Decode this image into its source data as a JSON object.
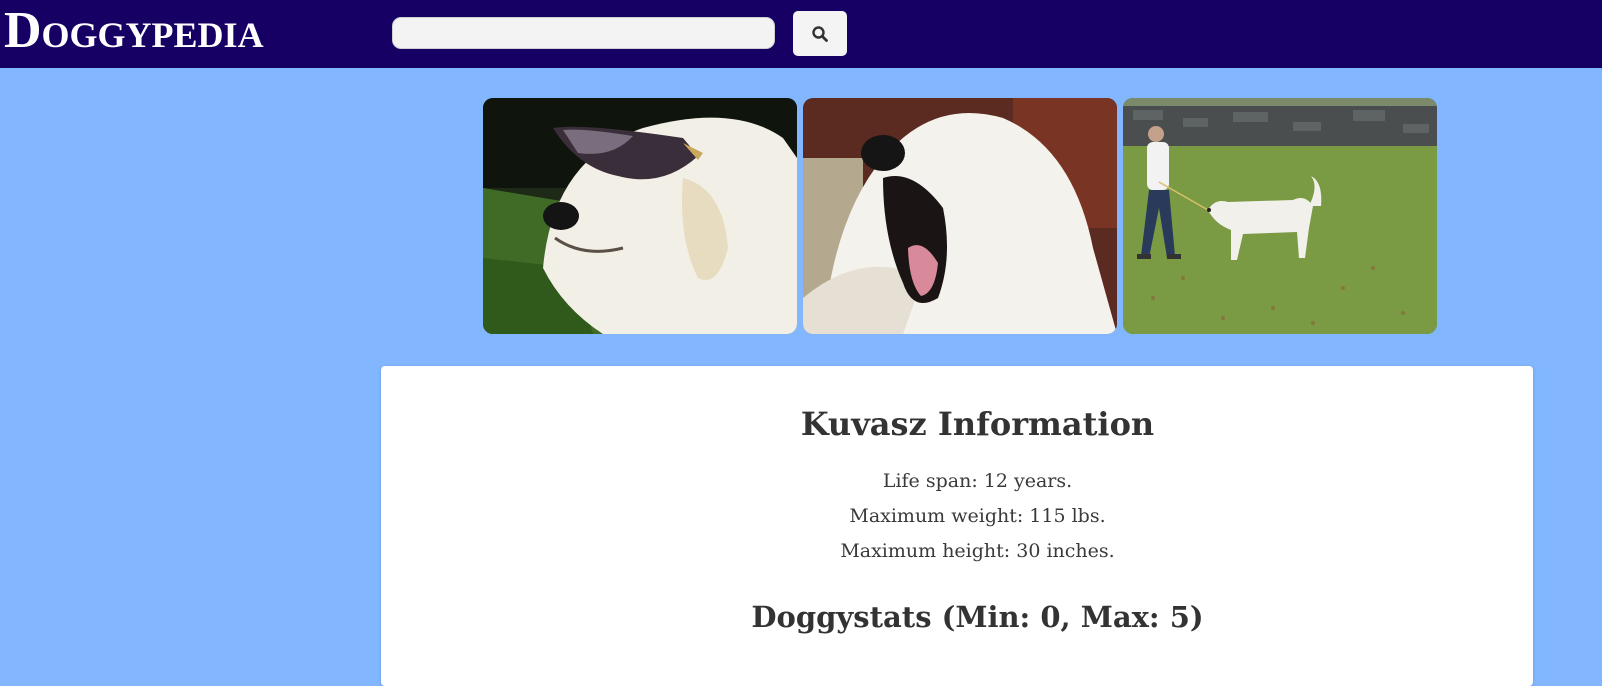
{
  "header": {
    "brand": "Doggypedia",
    "search": {
      "value": "",
      "placeholder": ""
    },
    "search_button_icon": "search-icon"
  },
  "gallery": {
    "photos": [
      {
        "description_icon": "dog-photo-sunglasses"
      },
      {
        "description_icon": "dog-photo-yawning"
      },
      {
        "description_icon": "dog-photo-walking"
      }
    ]
  },
  "breed_info": {
    "title": "Kuvasz Information",
    "life_span": "Life span: 12 years.",
    "max_weight": "Maximum weight: 115 lbs.",
    "max_height": "Maximum height: 30 inches.",
    "stats_title": "Doggystats (Min: 0, Max: 5)"
  },
  "colors": {
    "navbar": "#170064",
    "background": "#82b7ff",
    "card": "#ffffff"
  }
}
